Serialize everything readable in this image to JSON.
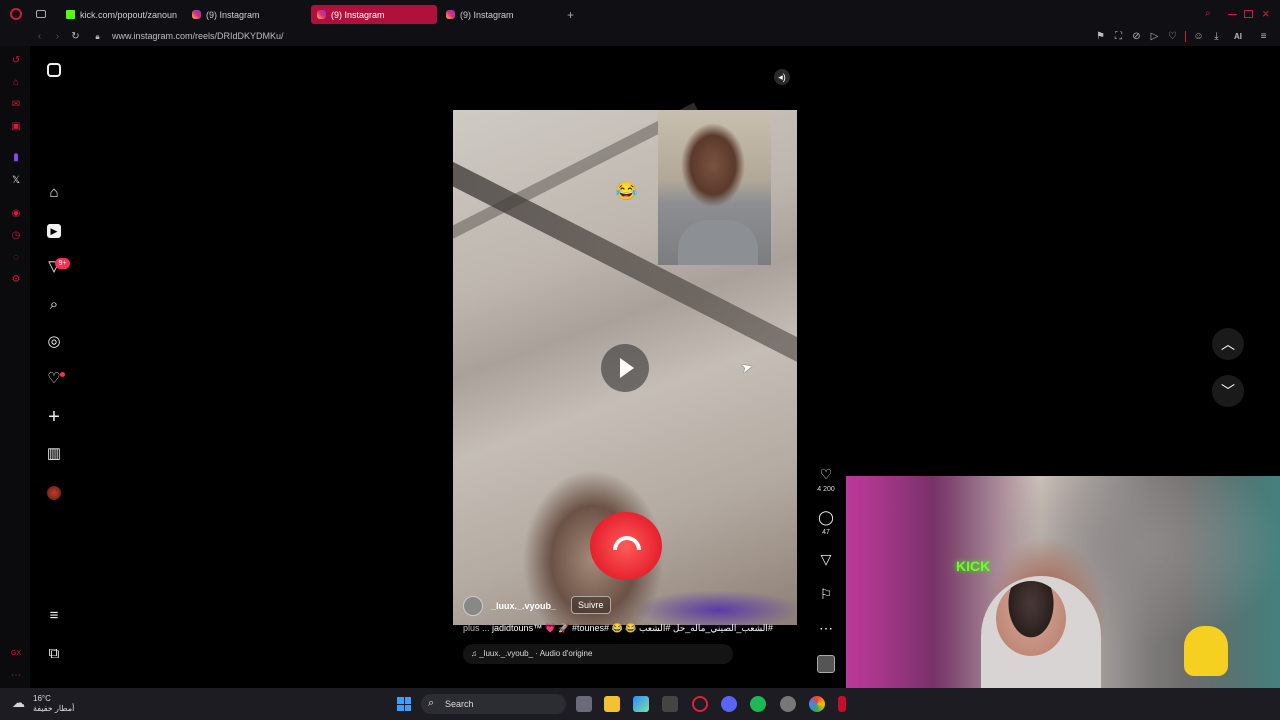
{
  "browser": {
    "tabs": [
      {
        "label": "kick.com/popout/zanoun",
        "icon": "kick-icon"
      },
      {
        "label": "(9) Instagram",
        "icon": "instagram-icon"
      },
      {
        "label": "(9) Instagram",
        "icon": "instagram-icon",
        "active": true
      },
      {
        "label": "(9) Instagram",
        "icon": "instagram-icon"
      }
    ],
    "url": "www.instagram.com/reels/DRIdDKYDMKu/",
    "ai_label": "AI"
  },
  "instagram_nav": {
    "notifications_badge": "9+",
    "items": [
      "instagram-logo-icon",
      "home-icon",
      "reels-icon",
      "messages-icon",
      "search-icon",
      "explore-icon",
      "notifications-heart-icon",
      "create-icon",
      "dashboard-icon",
      "profile-avatar",
      "more-menu-icon",
      "apps-icon"
    ]
  },
  "reel": {
    "emoji": "😂",
    "author": "_luux._.vyoub_",
    "follow_label": "Suivre",
    "caption_more": "plus ...",
    "caption_text": "jadidtouns™ 💗 🚀 #tounes# 😂 😂 الشعب_الصيني_ماله_حل #الشعب#",
    "audio_label": "_luux._.vyoub_ · Audio d'origine",
    "likes": "4 200",
    "comments": "47"
  },
  "webcam": {
    "sign_text": "KICK"
  },
  "taskbar": {
    "temperature": "16°C",
    "weather": "أمطار خفيفة",
    "search_placeholder": "Search"
  },
  "colors": {
    "opera_red": "#d01a3a",
    "active_tab": "#b0103c",
    "kick_green": "#53fc18"
  }
}
